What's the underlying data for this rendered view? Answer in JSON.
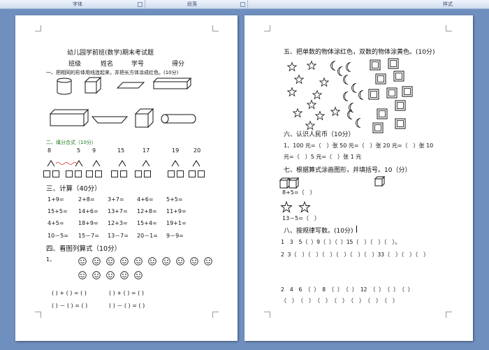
{
  "ribbon": {
    "font_group": "字体",
    "paragraph_group": "段落",
    "styles_group": "样式"
  },
  "left": {
    "title": "幼儿园学前班(数学)期末考试题",
    "header_fields": [
      "班级",
      "姓名",
      "学号",
      "得分"
    ],
    "q1": "一、把相同的形体用线连起来，并把长方体涂成红色。(10分)",
    "q2": "二、填分合式（10分）",
    "q2_numbers": [
      "8",
      "5",
      "9",
      "15",
      "17",
      "19",
      "20"
    ],
    "q3": "三、计算（40分）",
    "calc_rows": [
      [
        "1+9=",
        "2+8=",
        "3+7=",
        "4+6=",
        "5+5="
      ],
      [
        "15+5=",
        "14+6=",
        "13+7=",
        "12+8=",
        "11+9="
      ],
      [
        "4+5=",
        "18+9=",
        "12+3=",
        "15+4=",
        "19+1="
      ],
      [
        "10－5=",
        "15－7=",
        "13－7=",
        "20－1=",
        "9－9="
      ]
    ],
    "q4": "四、看图列算式（10分）",
    "q4_item": "1、",
    "q4_eq_row1": [
      "( ) + ( ) = ( )",
      "( ) + ( ) = ( )"
    ],
    "q4_eq_row2": [
      "( ) － ( ) = ( )",
      "( ) － ( ) = ( )"
    ]
  },
  "right": {
    "q5": "五、把单数的物体涂红色，双数的物体涂黄色。(10分)",
    "q6": "六、认识人民币（10分）",
    "q6_line1": "1、100 元=（　）张 50 元=（　）张 20 元=（　）张 10",
    "q6_line2": "元=（　）5 元=（　）张 1 元",
    "q7": "七、根据算式涂画图形，并填括号。10（分）",
    "q7_eq1": "8+5=（　）",
    "q7_eq2": "13－5=（　）",
    "q8": "八、按规律写数。(10分)",
    "seq1": "1　3　5（ ）9（ ）（ ）15（　）（　）（　）。",
    "seq2": "2 3（　）（　）（　）（　）（　）（　）33（　）（　）（　）",
    "seq3": "2　4　6　（ ）　8　（ ）　（ ）　12　（ ）　（ ）　（ ）",
    "seq4": "（　）　（　）　（　）　（　）　（　）　（　）　（　）"
  }
}
